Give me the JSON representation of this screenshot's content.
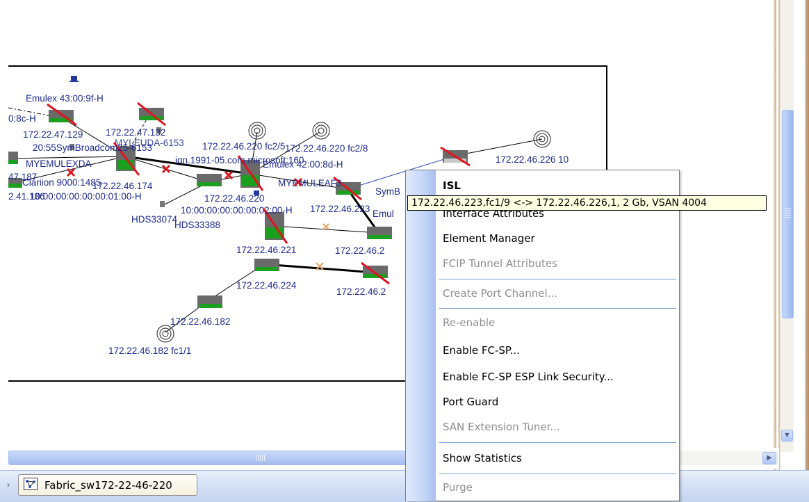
{
  "diagram": {
    "labels": [
      "Emulex 43:00:9f-H",
      "0:8c-H",
      "172.22.47.129",
      "172.22.47.132",
      "20:55SymBroadcom25-6153",
      "MYLEUDA-6153",
      "172.22.46.220 fc2/5",
      "172.22.46.220 fc2/8",
      "iqn.1991-05.com.microsoft:160",
      "Emulex 42:00:8d-H",
      "MYEMULEXDA",
      "Clariion 9000:1485",
      "172.22.46.174",
      "MYEMULEAF3",
      "SymB",
      "47.187",
      "2.41.186",
      "10:00:00:00:00:00:01:00-H",
      "172.22.46.220",
      "172.22.46.223",
      "Emul",
      "10:00:00:00:00:00:02:00-H",
      "HDS33074",
      "HDS33388",
      "172.22.46.221",
      "172.22.46.2",
      "172.22.46.224",
      "172.22.46.2",
      "172.22.46.182",
      "172.22.46.182 fc1/1",
      "172.22.46.226 10"
    ]
  },
  "tooltip": {
    "text": "172.22.46.223,fc1/9 <-> 172.22.46.226,1, 2 Gb, VSAN 4004"
  },
  "context_menu": {
    "items": [
      {
        "label": "ISL",
        "enabled": true
      },
      {
        "label": "Interface Attributes",
        "enabled": true
      },
      {
        "label": "Element Manager",
        "enabled": true
      },
      {
        "label": "FCIP Tunnel Attributes",
        "enabled": false
      },
      {
        "label": "Create Port Channel...",
        "enabled": false
      },
      {
        "label": "Re-enable",
        "enabled": false
      },
      {
        "label": "Enable FC-SP...",
        "enabled": true
      },
      {
        "label": "Enable FC-SP ESP Link Security...",
        "enabled": true
      },
      {
        "label": "Port Guard",
        "enabled": true
      },
      {
        "label": "SAN Extension Tuner...",
        "enabled": false
      },
      {
        "label": "Show Statistics",
        "enabled": true
      },
      {
        "label": "Purge",
        "enabled": false
      }
    ]
  },
  "taskbar": {
    "tab_label": "Fabric_sw172-22-46-220"
  },
  "colors": {
    "link_label": "#1d2a8f",
    "switch_green": "#18a01e",
    "fault_red": "#e0141e",
    "tooltip_bg": "#ffffe1",
    "menu_separator": "#7ea2dd"
  }
}
